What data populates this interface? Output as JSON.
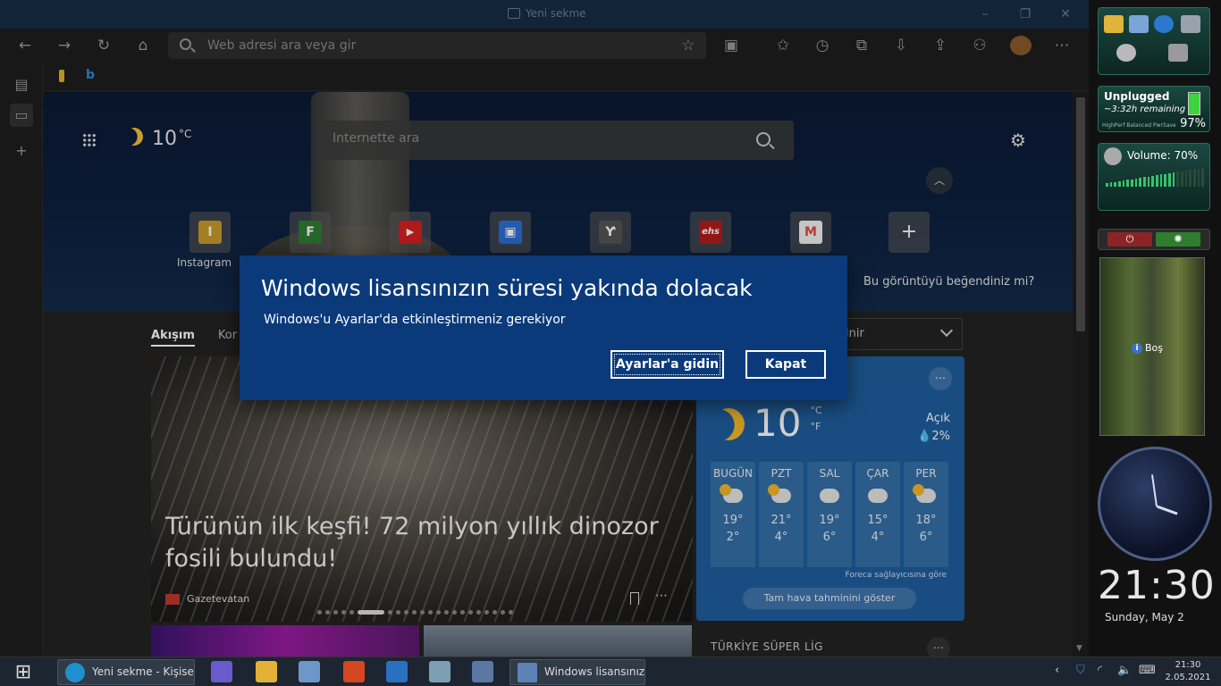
{
  "window": {
    "title": "Yeni sekme"
  },
  "addressbar": {
    "placeholder": "Web adresi ara veya gir"
  },
  "ntp": {
    "search_placeholder": "Internette ara",
    "temp": "10",
    "temp_unit": "°C",
    "quick_link_label": "Instagram",
    "tiles": [
      {
        "letter": "I",
        "color": "#c89a2a"
      },
      {
        "letter": "F",
        "color": "#2f7d32"
      },
      {
        "letter": "▶",
        "color": "#d62020"
      },
      {
        "letter": "▣",
        "color": "#2d6fd6"
      },
      {
        "letter": "Ƴ",
        "color": "#555555"
      },
      {
        "letter": "ehs",
        "color": "#b21e1e"
      },
      {
        "letter": "M",
        "color": "#e04b3a"
      },
      {
        "letter": "+",
        "color": "transparent"
      }
    ],
    "like_prompt": "Bu görüntüyü beğendiniz mi?",
    "tabs": [
      "Akışım",
      "Kor"
    ],
    "dropdown_partial": "inir"
  },
  "hero_article": {
    "headline": "Türünün ilk keşfi! 72 milyon yıllık dinozor fosili bulundu!",
    "source": "Gazetevatan"
  },
  "weather": {
    "temp": "10",
    "unit_c": "°C",
    "unit_f": "°F",
    "condition": "Açık",
    "precip": "💧2%",
    "days": [
      {
        "name": "BUGÜN",
        "hi": "19°",
        "lo": "2°",
        "icon": "partly-sunny"
      },
      {
        "name": "PZT",
        "hi": "21°",
        "lo": "4°",
        "icon": "partly-sunny"
      },
      {
        "name": "SAL",
        "hi": "19°",
        "lo": "6°",
        "icon": "cloudy"
      },
      {
        "name": "ÇAR",
        "hi": "15°",
        "lo": "4°",
        "icon": "cloudy"
      },
      {
        "name": "PER",
        "hi": "18°",
        "lo": "6°",
        "icon": "partly-sunny"
      }
    ],
    "attribution": "Foreca sağlayıcısına göre",
    "full_forecast": "Tam hava tahminini göster"
  },
  "league": {
    "title": "TÜRKİYE SÜPER LİG"
  },
  "dialog": {
    "title": "Windows lisansınızın süresi yakında dolacak",
    "message": "Windows'u Ayarlar'da etkinleştirmeniz gerekiyor",
    "primary": "Ayarlar'a gidin",
    "secondary": "Kapat"
  },
  "gadgets": {
    "battery_status": "Unplugged",
    "battery_remaining": "~3:32h remaining",
    "battery_modes": "HighPerf Balanced PwrSave",
    "battery_pct": "97%",
    "battery_level": 0.97,
    "volume": "Volume: 70%",
    "volume_level": 0.7,
    "photo_label": "Boş",
    "clock_time": "21:30",
    "clock_date": "Sunday, May 2"
  },
  "taskbar": {
    "tasks": [
      "Yeni sekme - Kişisel ...",
      "Windows lisansınızı..."
    ],
    "time": "21:30",
    "date": "2.05.2021"
  }
}
